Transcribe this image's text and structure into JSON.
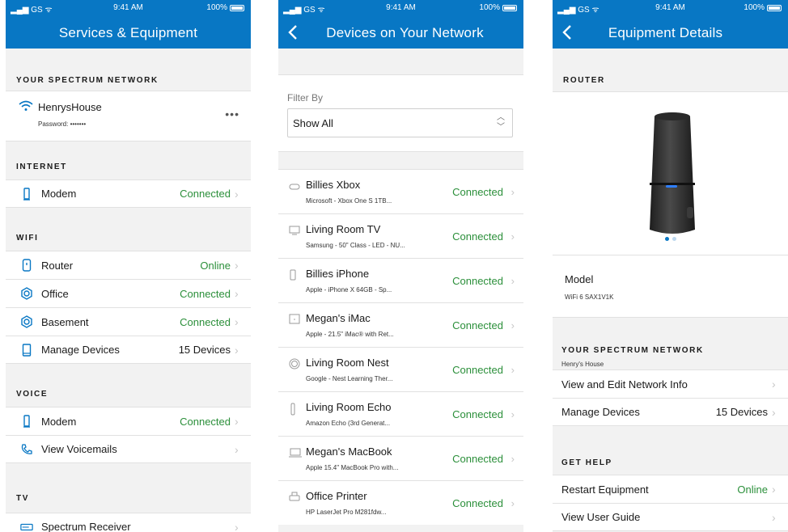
{
  "status_bar": {
    "carrier": "GS",
    "time": "9:41 AM",
    "battery": "100%"
  },
  "screen1": {
    "title": "Services & Equipment",
    "network_section": "YOUR SPECTRUM NETWORK",
    "network_name": "HenrysHouse",
    "network_password": "Password: •••••••",
    "more": "•••",
    "internet_section": "INTERNET",
    "internet_rows": [
      {
        "label": "Modem",
        "status": "Connected",
        "icon": "modem-icon"
      }
    ],
    "wifi_section": "WIFI",
    "wifi_rows": [
      {
        "label": "Router",
        "status": "Online",
        "icon": "router-icon"
      },
      {
        "label": "Office",
        "status": "Connected",
        "icon": "extender-icon"
      },
      {
        "label": "Basement",
        "status": "Connected",
        "icon": "extender-icon"
      },
      {
        "label": "Manage Devices",
        "status": "15 Devices",
        "icon": "tablet-icon"
      }
    ],
    "voice_section": "VOICE",
    "voice_rows": [
      {
        "label": "Modem",
        "status": "Connected",
        "icon": "modem-icon"
      },
      {
        "label": "View Voicemails",
        "status": "",
        "icon": "phone-icon"
      }
    ],
    "tv_section": "TV",
    "tv_rows": [
      {
        "label": "Spectrum Receiver",
        "status": "",
        "icon": "receiver-icon"
      }
    ]
  },
  "screen2": {
    "title": "Devices on Your Network",
    "filter_label": "Filter By",
    "filter_value": "Show All",
    "devices": [
      {
        "name": "Billies Xbox",
        "sub": "Microsoft - Xbox One S 1TB...",
        "status": "Connected",
        "icon": "gamepad-icon"
      },
      {
        "name": "Living Room TV",
        "sub": "Samsung - 50\" Class - LED - NU...",
        "status": "Connected",
        "icon": "tv-icon"
      },
      {
        "name": "Billies iPhone",
        "sub": "Apple - iPhone X 64GB - Sp...",
        "status": "Connected",
        "icon": "smartphone-icon"
      },
      {
        "name": "Megan's iMac",
        "sub": "Apple - 21.5\" iMac® with Ret...",
        "status": "Connected",
        "icon": "desktop-icon"
      },
      {
        "name": "Living Room Nest",
        "sub": "Google - Nest Learning Ther...",
        "status": "Connected",
        "icon": "thermostat-icon"
      },
      {
        "name": "Living Room Echo",
        "sub": "Amazon Echo (3rd Generat...",
        "status": "Connected",
        "icon": "speaker-icon"
      },
      {
        "name": "Megan's MacBook",
        "sub": "Apple 15.4\" MacBook Pro with...",
        "status": "Connected",
        "icon": "laptop-icon"
      },
      {
        "name": "Office Printer",
        "sub": "HP LaserJet Pro M281fdw...",
        "status": "Connected",
        "icon": "printer-icon"
      }
    ]
  },
  "screen3": {
    "title": "Equipment Details",
    "router_section": "ROUTER",
    "model_label": "Model",
    "model_value": "WiFi 6 SAX1V1K",
    "network_section": "YOUR SPECTRUM NETWORK",
    "network_name": "Henry's House",
    "network_rows": [
      {
        "label": "View and Edit Network Info",
        "status": ""
      },
      {
        "label": "Manage Devices",
        "status": "15 Devices"
      }
    ],
    "help_section": "GET HELP",
    "help_rows": [
      {
        "label": "Restart Equipment",
        "status": "Online"
      },
      {
        "label": "View User Guide",
        "status": ""
      }
    ]
  },
  "colors": {
    "brand": "#0877c4",
    "connected": "#2b8f3a",
    "divider": "#e1e1e1",
    "background": "#f2f2f2"
  }
}
